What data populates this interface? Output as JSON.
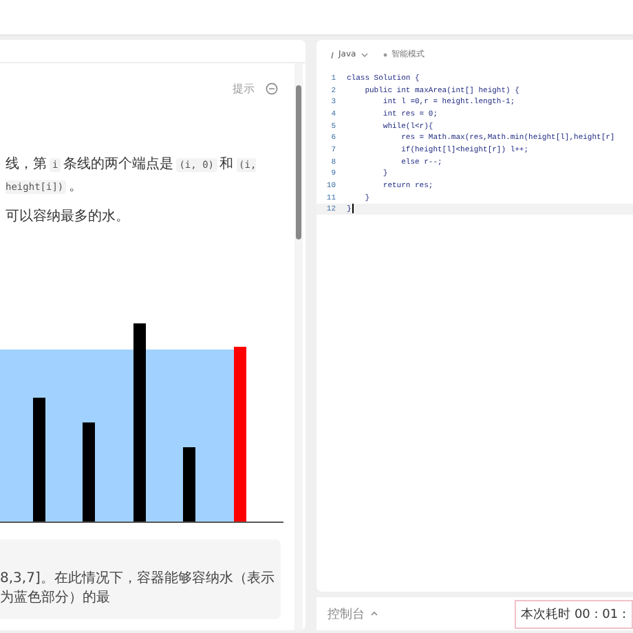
{
  "problem_panel": {
    "hint_button": "提示",
    "description": [
      [
        {
          "kind": "text",
          "text": "线，第"
        },
        {
          "kind": "code",
          "text": "i"
        },
        {
          "kind": "text",
          "text": "条线的两个端点是"
        },
        {
          "kind": "code",
          "text": "(i, 0)"
        },
        {
          "kind": "text",
          "text": "和"
        },
        {
          "kind": "code",
          "text": "(i, height[i])"
        },
        {
          "kind": "text",
          "text": "。"
        }
      ],
      [
        {
          "kind": "text",
          "text": "可以容纳最多的水。"
        }
      ]
    ],
    "example_text": "8,3,7]。在此情况下，容器能够容纳水（表示为蓝色部分）的最"
  },
  "editor": {
    "language": "Java",
    "mode": "智能模式",
    "lines": [
      {
        "number": "1",
        "code": "class Solution {",
        "current": false
      },
      {
        "number": "2",
        "code": "    public int maxArea(int[] height) {",
        "current": false
      },
      {
        "number": "3",
        "code": "        int l =0,r = height.length-1;",
        "current": false
      },
      {
        "number": "4",
        "code": "        int res = 0;",
        "current": false
      },
      {
        "number": "5",
        "code": "        while(l<r){",
        "current": false
      },
      {
        "number": "6",
        "code": "            res = Math.max(res,Math.min(height[l],height[r]",
        "current": false
      },
      {
        "number": "7",
        "code": "            if(height[l]<height[r]) l++;",
        "current": false
      },
      {
        "number": "8",
        "code": "            else r--;",
        "current": false
      },
      {
        "number": "9",
        "code": "        }",
        "current": false
      },
      {
        "number": "10",
        "code": "        return res;",
        "current": false
      },
      {
        "number": "11",
        "code": "    }",
        "current": false
      },
      {
        "number": "12",
        "code": "}",
        "current": true
      }
    ]
  },
  "console": {
    "label": "控制台",
    "timer": "本次耗时 00 : 01 :"
  }
}
